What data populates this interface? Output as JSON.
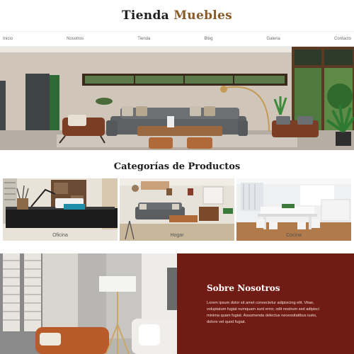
{
  "header": {
    "brand_first": "Tienda",
    "brand_second": "Muebles"
  },
  "nav": {
    "items": [
      "Inicio",
      "Nosotros",
      "Tienda",
      "Blog",
      "Galeria",
      "Contacto"
    ]
  },
  "categories": {
    "title": "Categorías de Productos",
    "items": [
      {
        "label": "Oficina"
      },
      {
        "label": "Hogar"
      },
      {
        "label": "Cocina"
      }
    ]
  },
  "about": {
    "title": "Sobre Nosotros",
    "text": "Lorem ipsum dolor sit amet consectetur adipisicing elit. Vitae, voluptatum fugiat numquam sunt error, odit nostrum sed adipisci minima quam fugiat. Assumenda delectus necessitatibus iusto, dolore vel quod fugiat."
  },
  "colors": {
    "brand_accent": "#8a5a2b",
    "about_panel": "#701c14"
  }
}
